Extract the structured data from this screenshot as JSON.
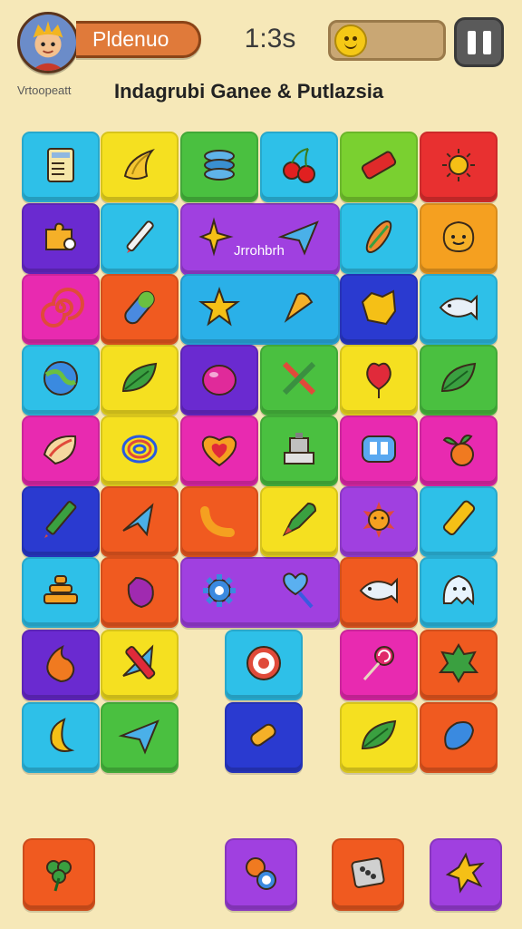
{
  "header": {
    "player_name": "Pldenuo",
    "timer": "1:3s",
    "pause_icon": "pause-icon",
    "mood_icon": "smiley-icon"
  },
  "subtitle_left": "Vrtoopeatt",
  "title": "Indagrubi Ganee & Putlazsia",
  "merged_label": "Jrrohbrh",
  "colors": {
    "background": "#f6e8b8",
    "name_pill": "#e07a3a",
    "pause_button": "#5a5a5a"
  },
  "board_icons": [
    "notepad-icon",
    "banana-icon",
    "ring-stack-icon",
    "cherries-icon",
    "red-bar-icon",
    "sun-icon",
    "puzzle-icon",
    "pencil-icon",
    "sparkle-icon",
    "paper-plane-icon",
    "surfboard-icon",
    "blob-face-icon",
    "spiral-icon",
    "capsule-icon",
    "star-icon",
    "cone-icon",
    "crumpled-icon",
    "fish-icon",
    "globe-icon",
    "leaf-icon",
    "orb-icon",
    "crossed-tools-icon",
    "balloon-icon",
    "leaf-icon",
    "shell-icon",
    "coil-icon",
    "heart-icon",
    "machine-icon",
    "frame-icon",
    "fruit-icon",
    "crayon-icon",
    "arrow-icon",
    "pipe-icon",
    "rocket-icon",
    "sun-creature-icon",
    "marker-icon",
    "pyramid-icon",
    "jar-icon",
    "gear-icon",
    "heart-key-icon",
    "fish-icon",
    "ghost-icon",
    "flame-icon",
    "crossed-arrow-icon",
    "target-icon",
    "lollipop-icon",
    "splat-icon",
    "moon-icon",
    "paper-plane-icon",
    "roller-icon",
    "leaf-icon",
    "bean-icon"
  ],
  "tray_icons": [
    "clover-icon",
    "dice-pair-icon",
    "dice-icon",
    "star-splat-icon"
  ]
}
